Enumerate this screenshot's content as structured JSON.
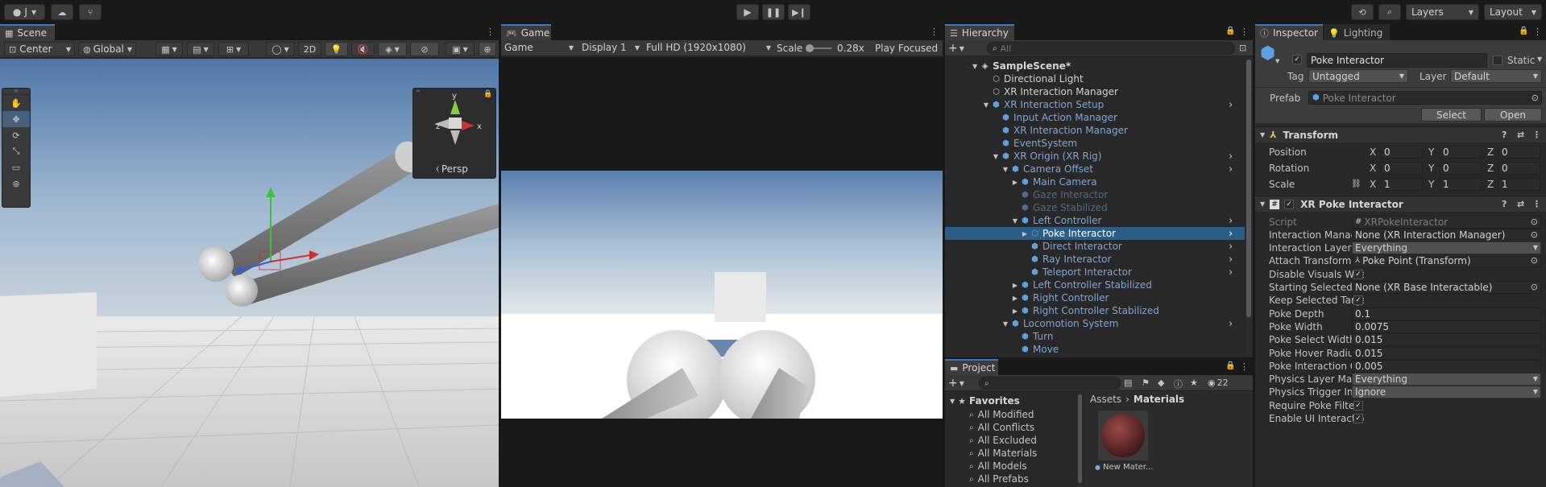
{
  "toolbar": {
    "account_label": "J",
    "layers_label": "Layers",
    "layout_label": "Layout"
  },
  "scene": {
    "tab_label": "Scene",
    "pivot_label": "Center",
    "space_label": "Global",
    "toggle_2d_label": "2D",
    "persp_label": "Persp",
    "gizmo_axes": {
      "y": "y",
      "x": "x",
      "z": "z"
    }
  },
  "game": {
    "tab_label": "Game",
    "mode_label": "Game",
    "display_label": "Display 1",
    "resolution_label": "Full HD (1920x1080)",
    "scale_label": "Scale",
    "scale_value": "0.28x",
    "play_focused_label": "Play Focused"
  },
  "hierarchy": {
    "tab_label": "Hierarchy",
    "search_placeholder": "All",
    "scene_name": "SampleScene*",
    "items": [
      {
        "label": "Directional Light",
        "depth": 1,
        "color": "normal"
      },
      {
        "label": "XR Interaction Manager",
        "depth": 1,
        "color": "normal"
      },
      {
        "label": "XR Interaction Setup",
        "depth": 1,
        "color": "blue",
        "expanded": true
      },
      {
        "label": "Input Action Manager",
        "depth": 2,
        "color": "blue"
      },
      {
        "label": "XR Interaction Manager",
        "depth": 2,
        "color": "blue"
      },
      {
        "label": "EventSystem",
        "depth": 2,
        "color": "blue"
      },
      {
        "label": "XR Origin (XR Rig)",
        "depth": 2,
        "color": "blue",
        "expanded": true
      },
      {
        "label": "Camera Offset",
        "depth": 3,
        "color": "blue",
        "expanded": true
      },
      {
        "label": "Main Camera",
        "depth": 4,
        "color": "blue",
        "collapsed": true
      },
      {
        "label": "Gaze Interactor",
        "depth": 4,
        "color": "dim"
      },
      {
        "label": "Gaze Stabilized",
        "depth": 4,
        "color": "dim"
      },
      {
        "label": "Left Controller",
        "depth": 4,
        "color": "blue",
        "expanded": true
      },
      {
        "label": "Poke Interactor",
        "depth": 5,
        "color": "normal",
        "selected": true
      },
      {
        "label": "Direct Interactor",
        "depth": 5,
        "color": "blue"
      },
      {
        "label": "Ray Interactor",
        "depth": 5,
        "color": "blue"
      },
      {
        "label": "Teleport Interactor",
        "depth": 5,
        "color": "blue"
      },
      {
        "label": "Left Controller Stabilized",
        "depth": 4,
        "color": "blue",
        "collapsed": true
      },
      {
        "label": "Right Controller",
        "depth": 4,
        "color": "blue",
        "collapsed": true
      },
      {
        "label": "Right Controller Stabilized",
        "depth": 4,
        "color": "blue",
        "collapsed": true
      },
      {
        "label": "Locomotion System",
        "depth": 3,
        "color": "blue",
        "expanded": true
      },
      {
        "label": "Turn",
        "depth": 4,
        "color": "blue"
      },
      {
        "label": "Move",
        "depth": 4,
        "color": "blue"
      }
    ]
  },
  "project": {
    "tab_label": "Project",
    "asset_count": "22",
    "favorites_label": "Favorites",
    "favorites": [
      "All Modified",
      "All Conflicts",
      "All Excluded",
      "All Materials",
      "All Models",
      "All Prefabs"
    ],
    "breadcrumb_root": "Assets",
    "breadcrumb_current": "Materials",
    "asset_name": "New Mater..."
  },
  "inspector": {
    "tab_label": "Inspector",
    "lighting_tab_label": "Lighting",
    "object_name": "Poke Interactor",
    "static_label": "Static",
    "tag_label": "Tag",
    "tag_value": "Untagged",
    "layer_label": "Layer",
    "layer_value": "Default",
    "prefab_label": "Prefab",
    "prefab_value": "Poke Interactor",
    "select_button": "Select",
    "open_button": "Open",
    "transform_title": "Transform",
    "position_label": "Position",
    "rotation_label": "Rotation",
    "scale_label": "Scale",
    "axis_x": "X",
    "axis_y": "Y",
    "axis_z": "Z",
    "position": [
      "0",
      "0",
      "0"
    ],
    "rotation": [
      "0",
      "0",
      "0"
    ],
    "scale": [
      "1",
      "1",
      "1"
    ],
    "component_title": "XR Poke Interactor",
    "properties": [
      {
        "label": "Script",
        "value": "XRPokeInteractor",
        "kind": "object",
        "disabled": true
      },
      {
        "label": "Interaction Manager",
        "value": "None (XR Interaction Manager)",
        "kind": "object"
      },
      {
        "label": "Interaction Layer Mas",
        "value": "Everything",
        "kind": "dropdown"
      },
      {
        "label": "Attach Transform",
        "value": "Poke Point (Transform)",
        "kind": "object"
      },
      {
        "label": "Disable Visuals When",
        "value": "✓",
        "kind": "check"
      },
      {
        "label": "Starting Selected Inte",
        "value": "None (XR Base Interactable)",
        "kind": "object"
      },
      {
        "label": "Keep Selected Target",
        "value": "✓",
        "kind": "check"
      },
      {
        "label": "Poke Depth",
        "value": "0.1",
        "kind": "text"
      },
      {
        "label": "Poke Width",
        "value": "0.0075",
        "kind": "text"
      },
      {
        "label": "Poke Select Width",
        "value": "0.015",
        "kind": "text"
      },
      {
        "label": "Poke Hover Radius",
        "value": "0.015",
        "kind": "text"
      },
      {
        "label": "Poke Interaction Offs",
        "value": "0.005",
        "kind": "text"
      },
      {
        "label": "Physics Layer Mask",
        "value": "Everything",
        "kind": "dropdown"
      },
      {
        "label": "Physics Trigger Intera",
        "value": "Ignore",
        "kind": "dropdown"
      },
      {
        "label": "Require Poke Filter",
        "value": "✓",
        "kind": "check"
      },
      {
        "label": "Enable UI Interaction",
        "value": "✓",
        "kind": "check"
      }
    ]
  },
  "colors": {
    "accent": "#3a79bb",
    "selection": "#2c5d87",
    "prefab_blue": "#7ba7e0"
  }
}
